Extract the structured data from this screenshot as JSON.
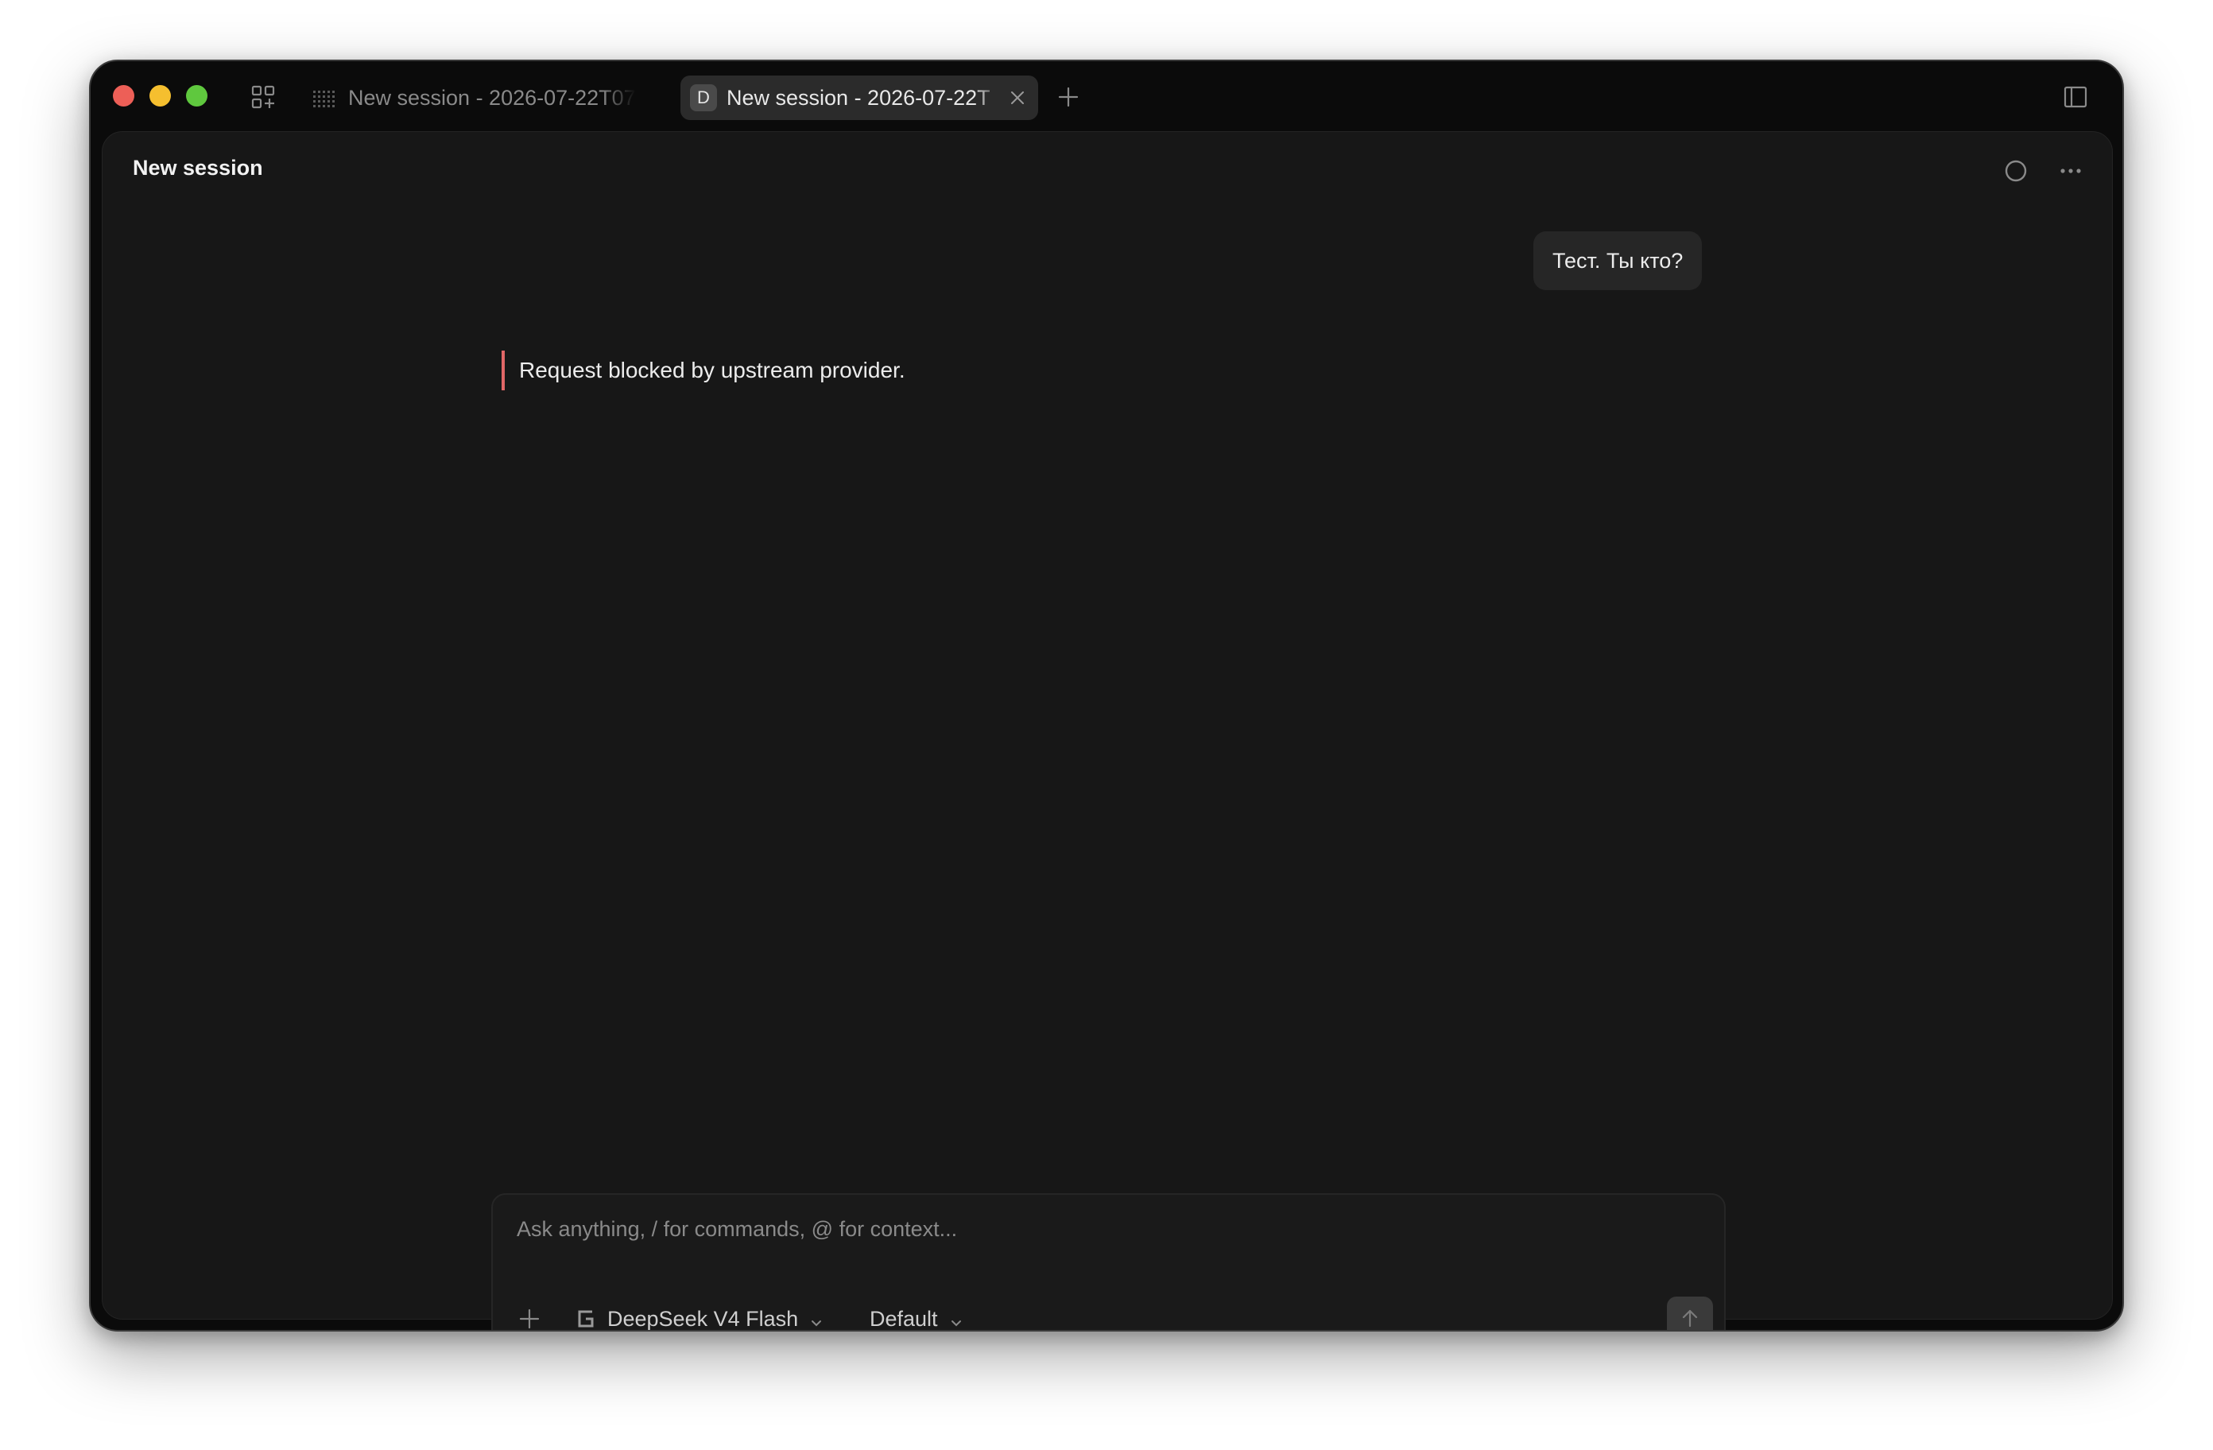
{
  "tabs": [
    {
      "label": "New session - 2026-07-22T07",
      "active": false
    },
    {
      "label": "New session - 2026-07-22T",
      "badge": "D",
      "active": true
    }
  ],
  "header": {
    "title": "New session"
  },
  "conversation": {
    "user_message": "Тест. Ты кто?",
    "error_message": "Request blocked by upstream provider."
  },
  "composer": {
    "placeholder": "Ask anything, / for commands, @ for context...",
    "value": "",
    "model": "DeepSeek V4 Flash",
    "mode": "Default"
  },
  "colors": {
    "window_bg": "#0b0b0b",
    "content_bg": "#171717",
    "error_accent": "#e16767",
    "traffic_red": "#ed5f57",
    "traffic_yellow": "#f5bf2f",
    "traffic_green": "#5fc83e"
  },
  "icons": {
    "grid": "grid-add-icon",
    "tab1": "dot-grid-icon",
    "close": "close-icon",
    "new_tab": "plus-icon",
    "sidebar": "sidebar-toggle-icon",
    "status": "circle-icon",
    "more": "ellipsis-icon",
    "model": "g-logo-icon",
    "send": "arrow-up-icon"
  }
}
